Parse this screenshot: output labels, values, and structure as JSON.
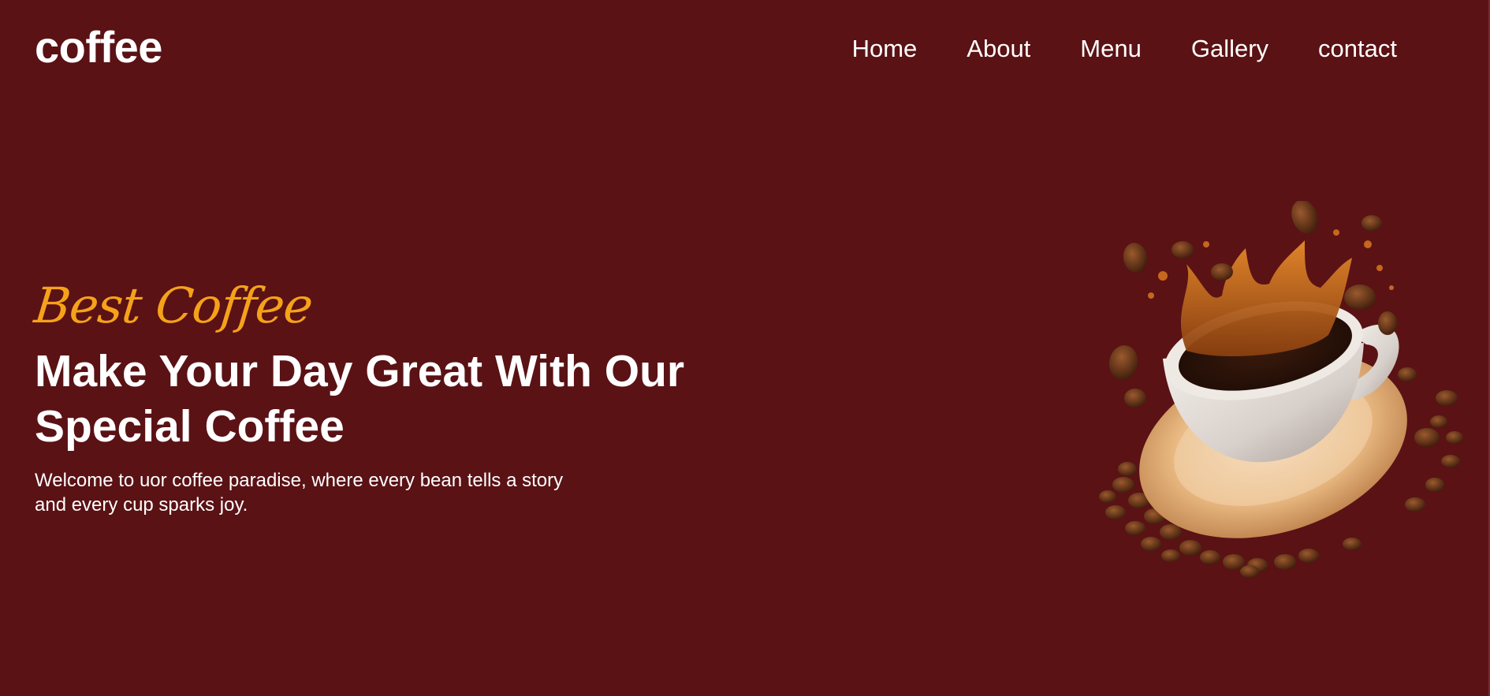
{
  "brand": {
    "logo": "coffee"
  },
  "nav": {
    "items": [
      {
        "label": "Home"
      },
      {
        "label": "About"
      },
      {
        "label": "Menu"
      },
      {
        "label": "Gallery"
      },
      {
        "label": "contact"
      }
    ]
  },
  "hero": {
    "kicker": "Best Coffee",
    "headline": "Make Your Day Great With Our Special Coffee",
    "subtext": "Welcome to uor coffee paradise, where every bean tells a story and every cup sparks joy."
  },
  "colors": {
    "background": "#5a1215",
    "accent": "#f5a21a",
    "text": "#ffffff"
  },
  "illustration": {
    "icon": "coffee-cup-splash-illustration"
  }
}
